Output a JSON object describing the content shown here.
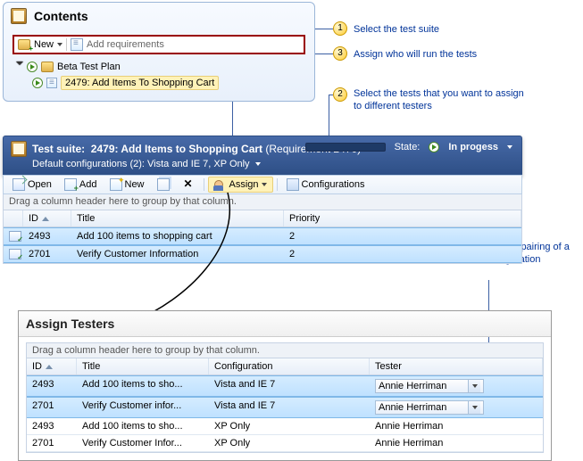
{
  "contents": {
    "title": "Contents",
    "new_label": "New",
    "add_req_label": "Add requirements",
    "tree": {
      "root_label": "Beta Test Plan",
      "child_label": "2479: Add Items To Shopping Cart"
    }
  },
  "suite_header": {
    "prefix": "Test suite:",
    "title": "2479: Add Items to Shopping Cart",
    "req": "(Requirement 2470)",
    "config_line": "Default configurations (2): Vista and IE 7, XP Only",
    "state_label": "State:",
    "state_value": "In progess"
  },
  "toolbar": {
    "open": "Open",
    "add": "Add",
    "new": "New",
    "assign": "Assign",
    "configurations": "Configurations"
  },
  "group_hint": "Drag a column header here to group by that column.",
  "grid1": {
    "headers": {
      "id": "ID",
      "title": "Title",
      "priority": "Priority"
    },
    "rows": [
      {
        "id": "2493",
        "title": "Add 100 items to shopping cart",
        "priority": "2"
      },
      {
        "id": "2701",
        "title": "Verify Customer Information",
        "priority": "2"
      }
    ]
  },
  "assign": {
    "panel_title": "Assign Testers",
    "headers": {
      "id": "ID",
      "title": "Title",
      "config": "Configuration",
      "tester": "Tester"
    },
    "rows": [
      {
        "id": "2493",
        "title": "Add 100 items to sho...",
        "config": "Vista and IE 7",
        "tester": "Annie Herriman",
        "selected": true,
        "dd": true
      },
      {
        "id": "2701",
        "title": "Verify Customer infor...",
        "config": "Vista and IE 7",
        "tester": "Annie Herriman",
        "selected": true,
        "dd": true
      },
      {
        "id": "2493",
        "title": "Add 100 items to sho...",
        "config": "XP Only",
        "tester": "Annie Herriman",
        "selected": false,
        "dd": false
      },
      {
        "id": "2701",
        "title": "Verify Customer Infor...",
        "config": "XP Only",
        "tester": "Annie Herriman",
        "selected": false,
        "dd": false
      }
    ]
  },
  "callouts": {
    "c1": "Select the test suite",
    "c2": "Select the tests that you want to assign to different testers",
    "c3": "Assign who will run the tests",
    "c4": "Edit who will run each pairing of a test case and configuration"
  }
}
